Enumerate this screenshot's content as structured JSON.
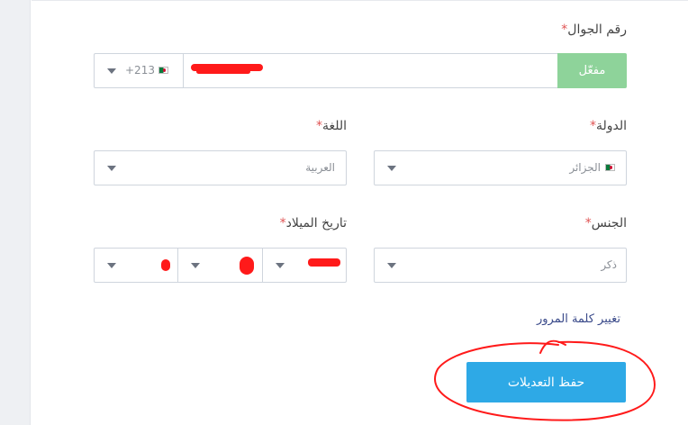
{
  "phone": {
    "label": "رقم الجوال",
    "required_mark": "*",
    "country_code": "+213",
    "verify_button": "مفعّل"
  },
  "language": {
    "label": "اللغة",
    "required_mark": "*",
    "value": "العربية"
  },
  "country": {
    "label": "الدولة",
    "required_mark": "*",
    "value": "الجزائر"
  },
  "birthdate": {
    "label": "تاريخ الميلاد",
    "required_mark": "*"
  },
  "gender": {
    "label": "الجنس",
    "required_mark": "*",
    "value": "ذكر"
  },
  "change_password_link": "تغيير كلمة المرور",
  "save_button": "حفظ التعديلات",
  "colors": {
    "accent": "#2ea9e6",
    "verified": "#8ed39a",
    "required": "#e05454",
    "annotation": "#ff1a1a"
  }
}
